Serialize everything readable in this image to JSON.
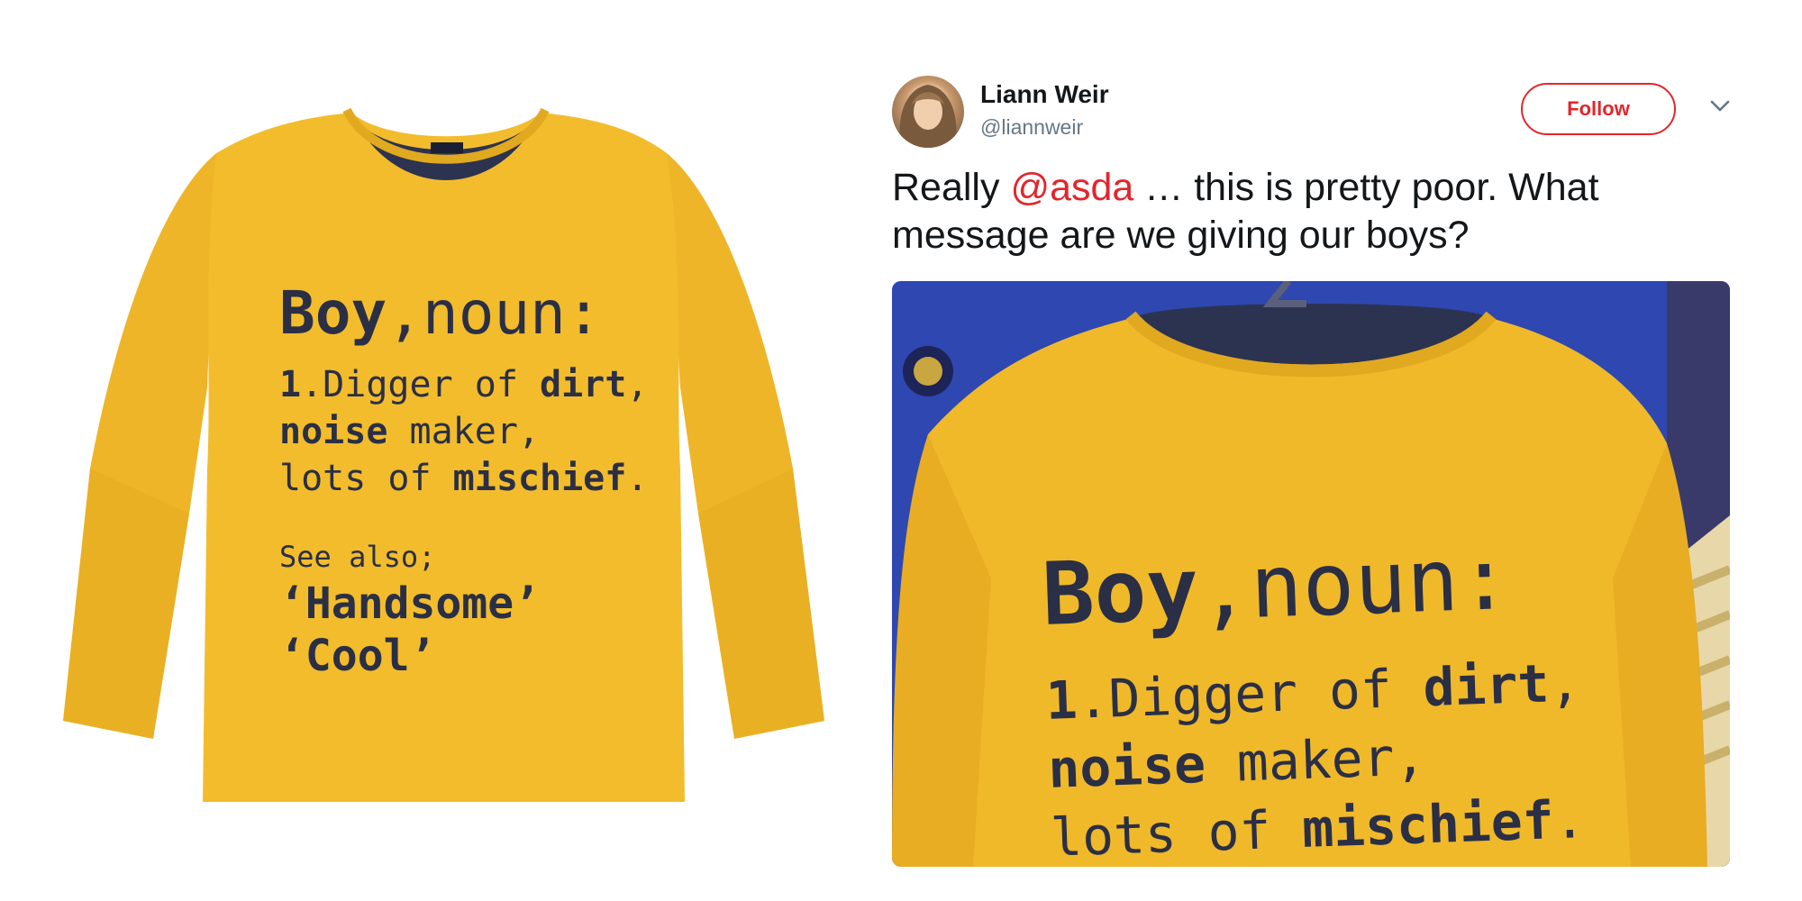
{
  "product": {
    "shirt_color": "#f2bc2c",
    "print_color": "#2a2f45",
    "headline_word": "Boy",
    "headline_rest": ",noun:",
    "definition_num": "1",
    "definition_line1_a": ".Digger of ",
    "definition_line1_b": "dirt",
    "definition_line1_c": ",",
    "definition_line2_a": "noise",
    "definition_line2_b": " maker,",
    "definition_line3_a": "lots of ",
    "definition_line3_b": "mischief",
    "definition_line3_c": ".",
    "see_also": "See also;",
    "word1": "‘Handsome’",
    "word2": "‘Cool’"
  },
  "tweet": {
    "user_name": "Liann Weir",
    "user_handle": "@liannweir",
    "follow_label": "Follow",
    "text_before": "Really ",
    "mention": "@asda",
    "text_after": " … this is pretty poor. What message are we giving our boys?",
    "accent_color": "#e2262c",
    "menu_icon": "chevron-down-icon",
    "photo": {
      "headline_word": "Boy",
      "headline_rest": ",noun:",
      "definition_num": "1",
      "line1_a": ".Digger of ",
      "line1_b": "dirt",
      "line1_c": ",",
      "line2_a": "noise",
      "line2_b": " maker,",
      "line3_a": "lots of ",
      "line3_b": "mischief",
      "line3_c": "."
    }
  }
}
